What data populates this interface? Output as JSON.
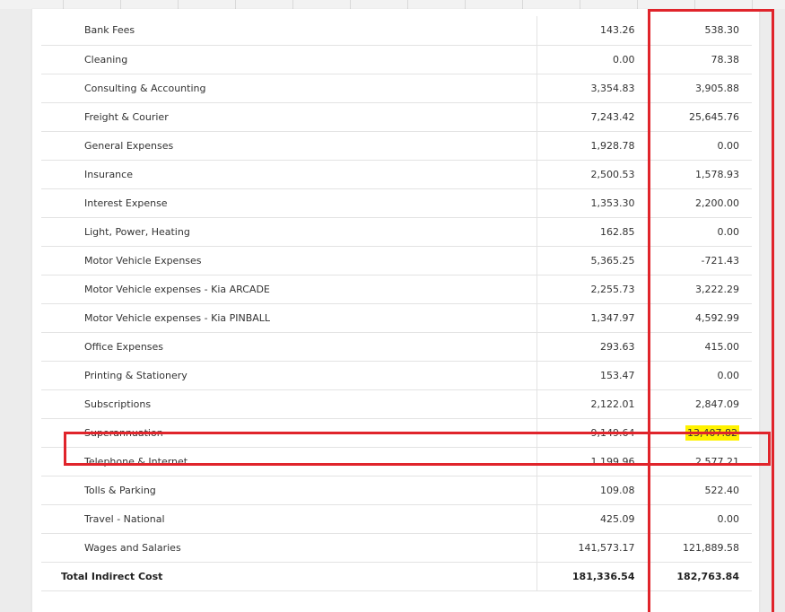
{
  "rows": [
    {
      "name": "Bank Fees",
      "v1": "143.26",
      "v2": "538.30"
    },
    {
      "name": "Cleaning",
      "v1": "0.00",
      "v2": "78.38"
    },
    {
      "name": "Consulting & Accounting",
      "v1": "3,354.83",
      "v2": "3,905.88"
    },
    {
      "name": "Freight & Courier",
      "v1": "7,243.42",
      "v2": "25,645.76"
    },
    {
      "name": "General Expenses",
      "v1": "1,928.78",
      "v2": "0.00"
    },
    {
      "name": "Insurance",
      "v1": "2,500.53",
      "v2": "1,578.93"
    },
    {
      "name": "Interest Expense",
      "v1": "1,353.30",
      "v2": "2,200.00"
    },
    {
      "name": "Light, Power, Heating",
      "v1": "162.85",
      "v2": "0.00"
    },
    {
      "name": "Motor Vehicle Expenses",
      "v1": "5,365.25",
      "v2": "-721.43"
    },
    {
      "name": "Motor Vehicle expenses - Kia ARCADE",
      "v1": "2,255.73",
      "v2": "3,222.29"
    },
    {
      "name": "Motor Vehicle expenses - Kia PINBALL",
      "v1": "1,347.97",
      "v2": "4,592.99"
    },
    {
      "name": "Office Expenses",
      "v1": "293.63",
      "v2": "415.00"
    },
    {
      "name": "Printing & Stationery",
      "v1": "153.47",
      "v2": "0.00"
    },
    {
      "name": "Subscriptions",
      "v1": "2,122.01",
      "v2": "2,847.09"
    },
    {
      "name": "Superannuation",
      "v1": "9,149.64",
      "v2": "13,407.82"
    },
    {
      "name": "Telephone & Internet",
      "v1": "1,199.96",
      "v2": "2,577.21"
    },
    {
      "name": "Tolls & Parking",
      "v1": "109.08",
      "v2": "522.40"
    },
    {
      "name": "Travel - National",
      "v1": "425.09",
      "v2": "0.00"
    },
    {
      "name": "Wages and Salaries",
      "v1": "141,573.17",
      "v2": "121,889.58"
    }
  ],
  "total": {
    "name": "Total Indirect Cost",
    "v1": "181,336.54",
    "v2": "182,763.84"
  },
  "annotation": {
    "box_color": "#e0242b",
    "highlight_color": "#fff200"
  }
}
